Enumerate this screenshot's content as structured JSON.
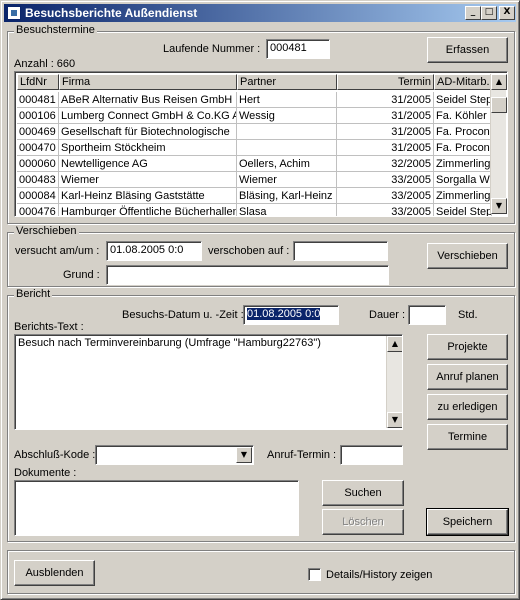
{
  "window": {
    "title": "Besuchsberichte Außendienst"
  },
  "controls": {
    "minimize": "_",
    "maximize": "□",
    "close": "X"
  },
  "besuchstermine": {
    "group_label": "Besuchstermine",
    "laufende_label": "Laufende Nummer :",
    "laufende_value": "000481",
    "erfassen_label": "Erfassen",
    "anzahl": "Anzahl : 660",
    "columns": [
      "LfdNr",
      "Firma",
      "Partner",
      "Termin",
      "AD-Mitarb."
    ],
    "rows": [
      [
        "000481",
        "ABeR Alternativ Bus Reisen GmbH",
        "Hert",
        "31/2005",
        "Seidel Step"
      ],
      [
        "000106",
        "Lumberg Connect GmbH & Co.KG A",
        "Wessig",
        "31/2005",
        "Fa. Köhler"
      ],
      [
        "000469",
        "Gesellschaft für Biotechnologische",
        "",
        "31/2005",
        "Fa. Procon"
      ],
      [
        "000470",
        "Sportheim Stöckheim",
        "",
        "31/2005",
        "Fa. Procon"
      ],
      [
        "000060",
        "Newtelligence AG",
        "Oellers, Achim",
        "32/2005",
        "Zimmerling I"
      ],
      [
        "000483",
        "Wiemer",
        "Wiemer",
        "33/2005",
        "Sorgalla We"
      ],
      [
        "000084",
        "Karl-Heinz Bläsing Gaststätte",
        "Bläsing, Karl-Heinz",
        "33/2005",
        "Zimmerling I"
      ],
      [
        "000476",
        "Hamburger Öffentliche Bücherhallen",
        "Slasa",
        "33/2005",
        "Seidel Step"
      ]
    ]
  },
  "verschieben": {
    "group_label": "Verschieben",
    "versucht_label": "versucht am/um :",
    "versucht_value": "01.08.2005 0:0",
    "verschoben_label": "verschoben auf :",
    "verschoben_value": "",
    "grund_label": "Grund :",
    "grund_value": "",
    "button_label": "Verschieben"
  },
  "bericht": {
    "group_label": "Bericht",
    "datum_label": "Besuchs-Datum u. -Zeit :",
    "datum_value": "01.08.2005 0:0",
    "dauer_label": "Dauer :",
    "dauer_value": "",
    "std_label": "Std.",
    "text_label": "Berichts-Text :",
    "text_value": "Besuch nach Terminvereinbarung (Umfrage \"Hamburg22763\")",
    "buttons": [
      "Projekte",
      "Anruf planen",
      "zu erledigen",
      "Termine"
    ],
    "abschluss_label": "Abschluß-Kode :",
    "abschluss_value": "",
    "anruf_label": "Anruf-Termin :",
    "anruf_value": "",
    "dokumente_label": "Dokumente :",
    "suchen_label": "Suchen",
    "loeschen_label": "Löschen",
    "speichern_label": "Speichern"
  },
  "footer": {
    "ausblenden_label": "Ausblenden",
    "details_label": "Details/History zeigen",
    "details_checked": false
  }
}
